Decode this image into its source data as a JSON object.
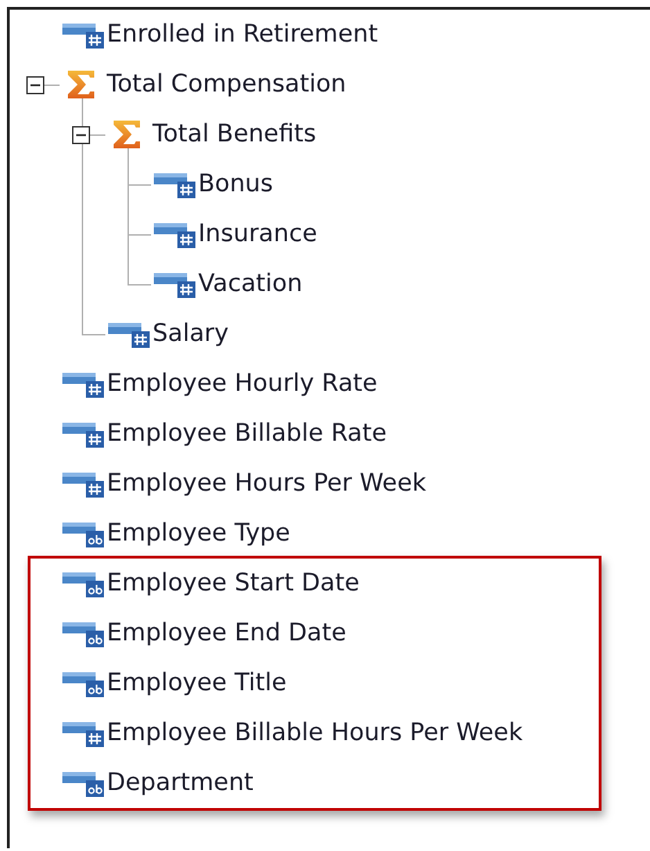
{
  "tree": [
    {
      "label": "Enrolled in Retirement",
      "kind": "number",
      "highlighted": false
    },
    {
      "label": "Total Compensation",
      "kind": "sum",
      "expanded": true,
      "highlighted": false,
      "children": [
        {
          "label": "Total Benefits",
          "kind": "sum",
          "expanded": true,
          "children": [
            {
              "label": "Bonus",
              "kind": "number"
            },
            {
              "label": "Insurance",
              "kind": "number"
            },
            {
              "label": "Vacation",
              "kind": "number"
            }
          ]
        },
        {
          "label": "Salary",
          "kind": "number"
        }
      ]
    },
    {
      "label": "Employee Hourly Rate",
      "kind": "number",
      "highlighted": false
    },
    {
      "label": "Employee Billable Rate",
      "kind": "number",
      "highlighted": false
    },
    {
      "label": "Employee Hours Per Week",
      "kind": "number",
      "highlighted": false
    },
    {
      "label": "Employee Type",
      "kind": "text",
      "highlighted": false
    },
    {
      "label": "Employee Start Date",
      "kind": "text",
      "highlighted": true
    },
    {
      "label": "Employee End Date",
      "kind": "text",
      "highlighted": true
    },
    {
      "label": "Employee Title",
      "kind": "text",
      "highlighted": true
    },
    {
      "label": "Employee Billable Hours Per Week",
      "kind": "number",
      "highlighted": true
    },
    {
      "label": "Department",
      "kind": "text",
      "highlighted": true
    }
  ]
}
